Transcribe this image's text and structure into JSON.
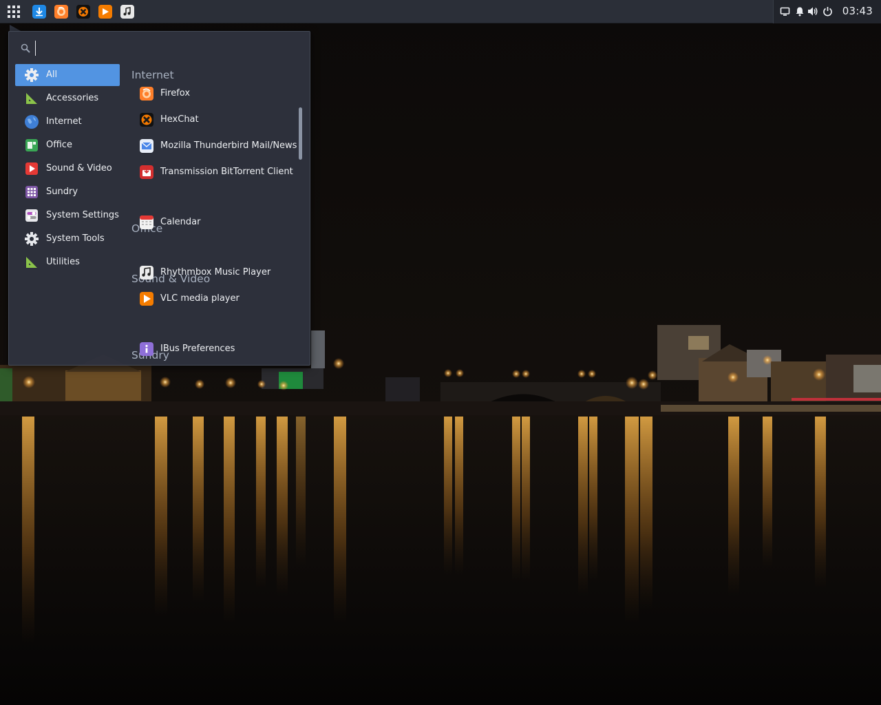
{
  "panel": {
    "launchers": [
      {
        "icon": "download-icon",
        "color": "#1e88e5"
      },
      {
        "icon": "firefox-icon",
        "color": "#ff7f2a"
      },
      {
        "icon": "hexchat-icon",
        "color": "#f57900"
      },
      {
        "icon": "vlc-icon",
        "color": "#f57c00"
      },
      {
        "icon": "music-player-icon",
        "color": "#e8e8e8"
      }
    ],
    "clock": "03:43"
  },
  "menu": {
    "search": {
      "value": "",
      "placeholder": ""
    },
    "categories": [
      {
        "label": "All",
        "icon": "gear-icon",
        "active": true
      },
      {
        "label": "Accessories",
        "icon": "set-square-icon"
      },
      {
        "label": "Internet",
        "icon": "globe-icon"
      },
      {
        "label": "Office",
        "icon": "office-icon"
      },
      {
        "label": "Sound & Video",
        "icon": "media-play-icon"
      },
      {
        "label": "Sundry",
        "icon": "grid-icon"
      },
      {
        "label": "System Settings",
        "icon": "toggle-settings-icon"
      },
      {
        "label": "System Tools",
        "icon": "gear-icon"
      },
      {
        "label": "Utilities",
        "icon": "set-square-icon"
      }
    ],
    "sections": [
      {
        "title": "Internet",
        "apps": [
          {
            "label": "Firefox",
            "icon": "firefox-icon"
          },
          {
            "label": "HexChat",
            "icon": "hexchat-icon"
          },
          {
            "label": "Mozilla Thunderbird Mail/News",
            "icon": "mail-icon"
          },
          {
            "label": "Transmission BitTorrent Client",
            "icon": "transmission-icon"
          }
        ]
      },
      {
        "title": "Office",
        "apps": [
          {
            "label": "Calendar",
            "icon": "calendar-icon"
          }
        ]
      },
      {
        "title": "Sound & Video",
        "apps": [
          {
            "label": "Rhythmbox Music Player",
            "icon": "music-player-icon"
          },
          {
            "label": "VLC media player",
            "icon": "vlc-icon"
          }
        ]
      },
      {
        "title": "Sundry",
        "apps": [
          {
            "label": "IBus Preferences",
            "icon": "info-icon"
          }
        ]
      }
    ]
  },
  "colors": {
    "accent": "#5294e2",
    "menu_bg": "#2e323d",
    "panel_bg": "#2b2f38"
  }
}
